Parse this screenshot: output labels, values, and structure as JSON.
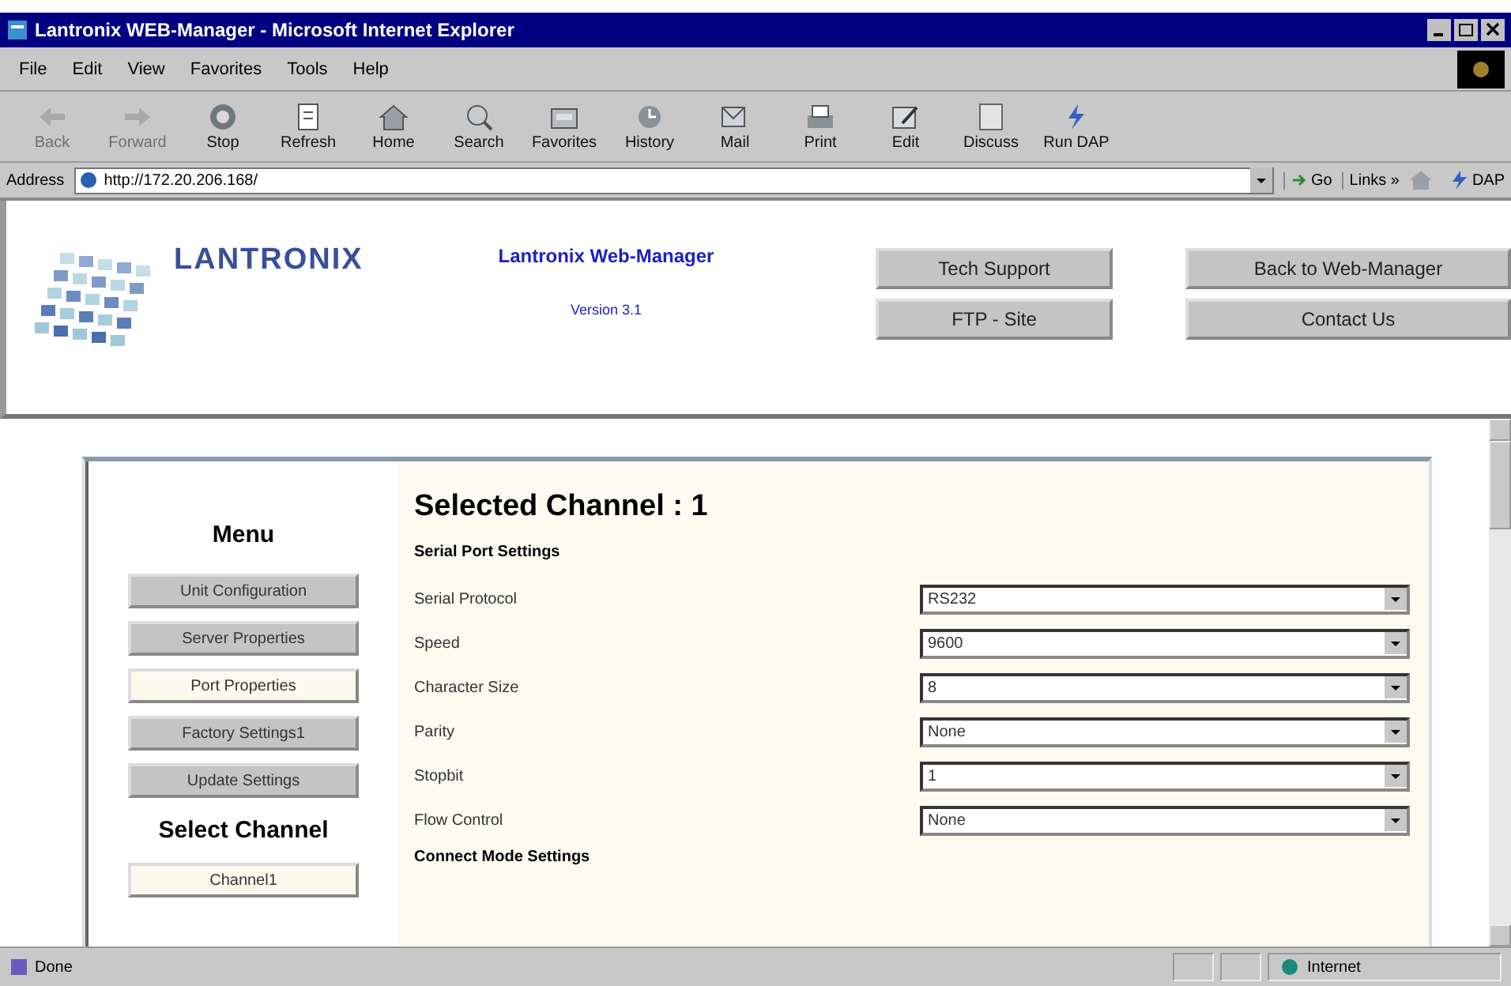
{
  "window": {
    "title": "Lantronix WEB-Manager - Microsoft Internet Explorer"
  },
  "menu_bar": [
    "File",
    "Edit",
    "View",
    "Favorites",
    "Tools",
    "Help"
  ],
  "toolbar": [
    {
      "kind": "back",
      "label": "Back",
      "disabled": true
    },
    {
      "kind": "forward",
      "label": "Forward",
      "disabled": true
    },
    {
      "kind": "stop",
      "label": "Stop",
      "disabled": false
    },
    {
      "kind": "refresh",
      "label": "Refresh",
      "disabled": false
    },
    {
      "kind": "home",
      "label": "Home",
      "disabled": false
    },
    {
      "kind": "search",
      "label": "Search",
      "disabled": false
    },
    {
      "kind": "favorites",
      "label": "Favorites",
      "disabled": false
    },
    {
      "kind": "history",
      "label": "History",
      "disabled": false
    },
    {
      "kind": "mail",
      "label": "Mail",
      "disabled": false
    },
    {
      "kind": "print",
      "label": "Print",
      "disabled": false
    },
    {
      "kind": "edit",
      "label": "Edit",
      "disabled": false
    },
    {
      "kind": "discuss",
      "label": "Discuss",
      "disabled": false
    },
    {
      "kind": "dap",
      "label": "Run DAP",
      "disabled": false
    }
  ],
  "address_bar": {
    "label": "Address",
    "value": "http://172.20.206.168/",
    "go": "Go",
    "links": "Links »",
    "dap": "DAP"
  },
  "header": {
    "logo": "LANTRONIX",
    "app_title": "Lantronix Web-Manager",
    "version": "Version 3.1",
    "buttons": [
      "Tech Support",
      "Back to Web-Manager",
      "FTP - Site",
      "Contact Us"
    ]
  },
  "sidebar": {
    "heading": "Menu",
    "items": [
      {
        "label": "Unit Configuration",
        "selected": false
      },
      {
        "label": "Server Properties",
        "selected": false
      },
      {
        "label": "Port Properties",
        "selected": true
      },
      {
        "label": "Factory Settings1",
        "selected": false
      },
      {
        "label": "Update Settings",
        "selected": false
      }
    ],
    "channel_heading": "Select Channel",
    "channels": [
      {
        "label": "Channel1",
        "selected": true
      }
    ]
  },
  "main": {
    "title": "Selected Channel : 1",
    "section": "Serial Port Settings",
    "fields": [
      {
        "label": "Serial Protocol",
        "value": "RS232"
      },
      {
        "label": "Speed",
        "value": "9600"
      },
      {
        "label": "Character Size",
        "value": "8"
      },
      {
        "label": "Parity",
        "value": "None"
      },
      {
        "label": "Stopbit",
        "value": "1"
      },
      {
        "label": "Flow Control",
        "value": "None"
      }
    ],
    "next_section": "Connect Mode Settings"
  },
  "status_bar": {
    "text": "Done",
    "zone": "Internet"
  }
}
